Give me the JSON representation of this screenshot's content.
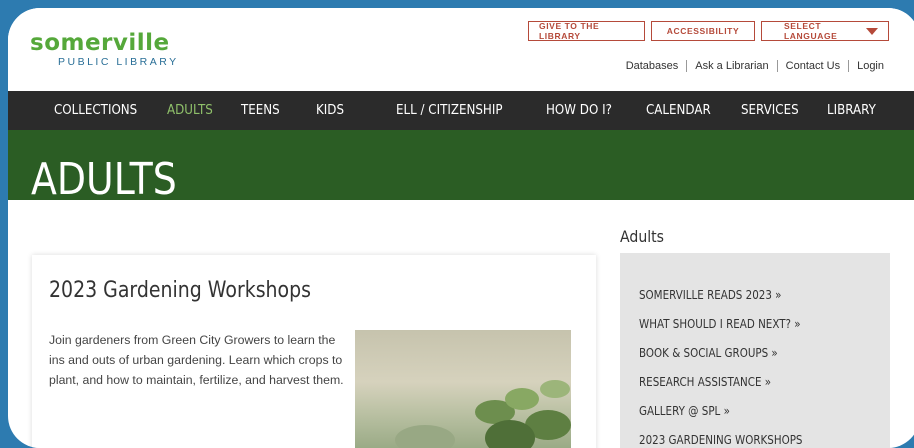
{
  "header": {
    "logo_main": "somerville",
    "logo_sub": "PUBLIC LIBRARY",
    "buttons": {
      "give": "GIVE TO THE LIBRARY",
      "accessibility": "ACCESSIBILITY",
      "language": "SELECT LANGUAGE"
    },
    "utility_links": [
      "Databases",
      "Ask a Librarian",
      "Contact Us",
      "Login"
    ]
  },
  "nav": {
    "items": [
      "COLLECTIONS",
      "ADULTS",
      "TEENS",
      "KIDS",
      "ELL / CITIZENSHIP",
      "HOW DO I?",
      "CALENDAR",
      "SERVICES",
      "LIBRARY"
    ],
    "active": "ADULTS"
  },
  "banner": {
    "title": "ADULTS"
  },
  "card": {
    "title": "2023 Gardening Workshops",
    "text": "Join gardeners from Green City Growers to learn the ins and outs of urban gardening. Learn which crops to plant, and how to maintain, fertilize, and harvest them."
  },
  "sidebar": {
    "heading": "Adults",
    "items": [
      "SOMERVILLE READS 2023 »",
      "WHAT SHOULD I READ NEXT? »",
      "BOOK & SOCIAL GROUPS »",
      "RESEARCH ASSISTANCE »",
      "GALLERY @ SPL »",
      "2023 GARDENING WORKSHOPS"
    ]
  },
  "colors": {
    "background": "#2d7bb0",
    "nav_bg": "#2b2b2b",
    "nav_active": "#8fc06a",
    "banner_bg": "#2b5d24",
    "accent_red": "#b54a3a",
    "logo_green": "#55a83a",
    "logo_blue": "#2a6f97"
  }
}
